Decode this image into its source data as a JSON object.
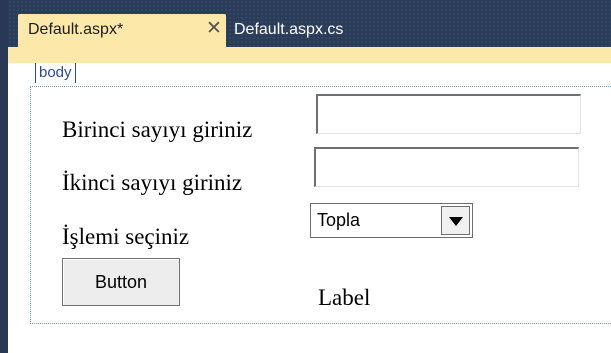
{
  "tabs": [
    {
      "label": "Default.aspx*",
      "active": true,
      "close_icon": "close-icon"
    },
    {
      "label": "Default.aspx.cs",
      "active": false
    }
  ],
  "designer": {
    "body_tag": "body"
  },
  "form": {
    "label_first": "Birinci sayıyı giriniz",
    "label_second": "İkinci sayıyı giriniz",
    "label_operation": "İşlemi seçiniz",
    "first_value": "",
    "second_value": "",
    "operation_selected": "Topla",
    "button_label": "Button",
    "result_label": "Label"
  },
  "colors": {
    "frame": "#293955",
    "active_tab": "#fce9a9",
    "tag_text": "#2b4aa0"
  }
}
